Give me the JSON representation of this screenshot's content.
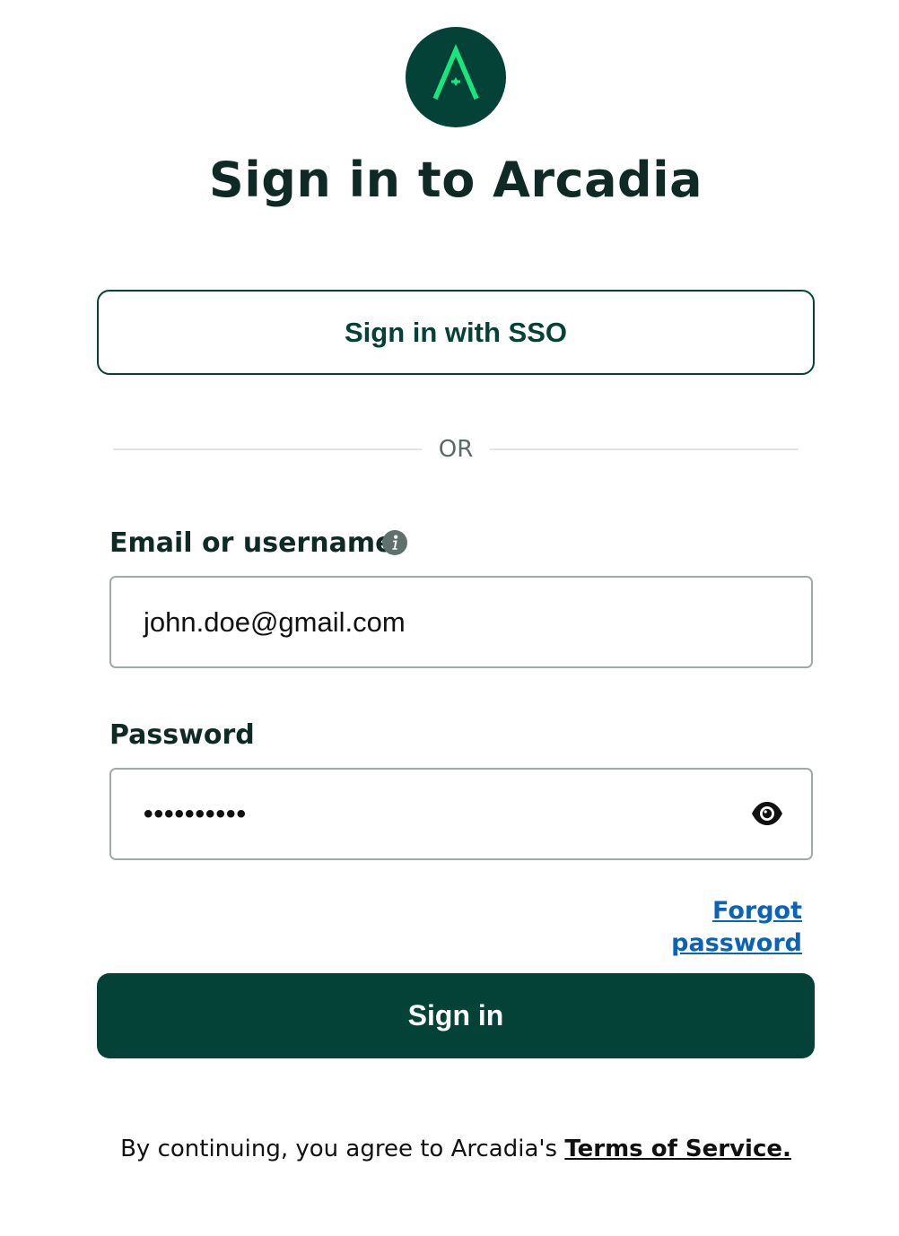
{
  "brand": {
    "logo_icon": "arcadia-logo-icon",
    "logo_bg_color": "#044237",
    "logo_mark_color": "#19e57f"
  },
  "title": "Sign in to Arcadia",
  "sso_button_label": "Sign in with SSO",
  "divider_text": "OR",
  "email": {
    "label": "Email or username",
    "value": "john.doe@gmail.com",
    "info_icon": "info-icon"
  },
  "password": {
    "label": "Password",
    "masked_value": "••••••••••",
    "toggle_icon": "eye-icon"
  },
  "forgot_password_label": "Forgot password",
  "signin_button_label": "Sign in",
  "terms": {
    "prefix": "By continuing, you agree to Arcadia's ",
    "link_label": "Terms of Service."
  },
  "colors": {
    "primary": "#044237",
    "link": "#0b63b7",
    "border": "#a2aaa8"
  }
}
